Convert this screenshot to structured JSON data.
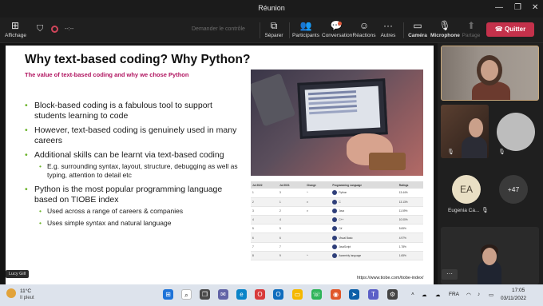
{
  "window": {
    "title": "Réunion",
    "minimize": "—",
    "maximize": "❐",
    "close": "✕"
  },
  "toolbar": {
    "display_label": "Affichage",
    "timer": "--:--",
    "raise_hand": "Demander le contrôle",
    "separate": "Séparer",
    "participants": "Participants",
    "conversation": "Conversation",
    "reactions": "Réactions",
    "others": "Autres",
    "camera": "Caméra",
    "microphone": "Microphone",
    "share": "Partage",
    "quit": "Quitter"
  },
  "slide": {
    "title": "Why text-based coding? Why Python?",
    "subtitle": "The value of text-based coding and why we chose Python",
    "bullets": [
      {
        "text": "Block-based coding is a fabulous tool to support students learning to code"
      },
      {
        "text": "However, text-based coding is genuinely used in many careers"
      },
      {
        "text": "Additional skills can be learnt via text-based coding"
      },
      {
        "text": "E.g. surrounding syntax, layout, structure, debugging as well as typing, attention to detail etc"
      },
      {
        "text": "Python is the most popular programming language based on TIOBE index"
      },
      {
        "text": "Used across a range of careers & companies"
      },
      {
        "text": "Uses simple syntax and natural language"
      }
    ],
    "table": {
      "headers": [
        "Jul 2022",
        "Jul 2021",
        "Change",
        "Programming Language",
        "Ratings"
      ],
      "rows": [
        [
          "1",
          "3",
          "^",
          "Python",
          "13.44%"
        ],
        [
          "2",
          "1",
          "v",
          "C",
          "13.13%"
        ],
        [
          "3",
          "2",
          "v",
          "Java",
          "11.59%"
        ],
        [
          "4",
          "4",
          "",
          "C++",
          "10.00%"
        ],
        [
          "5",
          "5",
          "",
          "C#",
          "5.65%"
        ],
        [
          "6",
          "6",
          "",
          "Visual Basic",
          "4.97%"
        ],
        [
          "7",
          "7",
          "",
          "JavaScript",
          "1.78%"
        ],
        [
          "8",
          "9",
          "^",
          "Assembly language",
          "1.65%"
        ]
      ]
    },
    "url": "https://www.tiobe.com/tiobe-index/"
  },
  "speaker": {
    "label": "Lucy Gill"
  },
  "participants": {
    "ea_initials": "EA",
    "ea_name": "Eugenia Ca...",
    "overflow": "+47",
    "more": "···"
  },
  "taskbar": {
    "temperature": "11°C",
    "weather": "Il pleut",
    "language": "FRA",
    "time": "17:05",
    "date": "03/11/2022"
  },
  "colors": {
    "quit": "#c4314b",
    "subtitle": "#b0135f",
    "bullet": "#6bb32a"
  }
}
